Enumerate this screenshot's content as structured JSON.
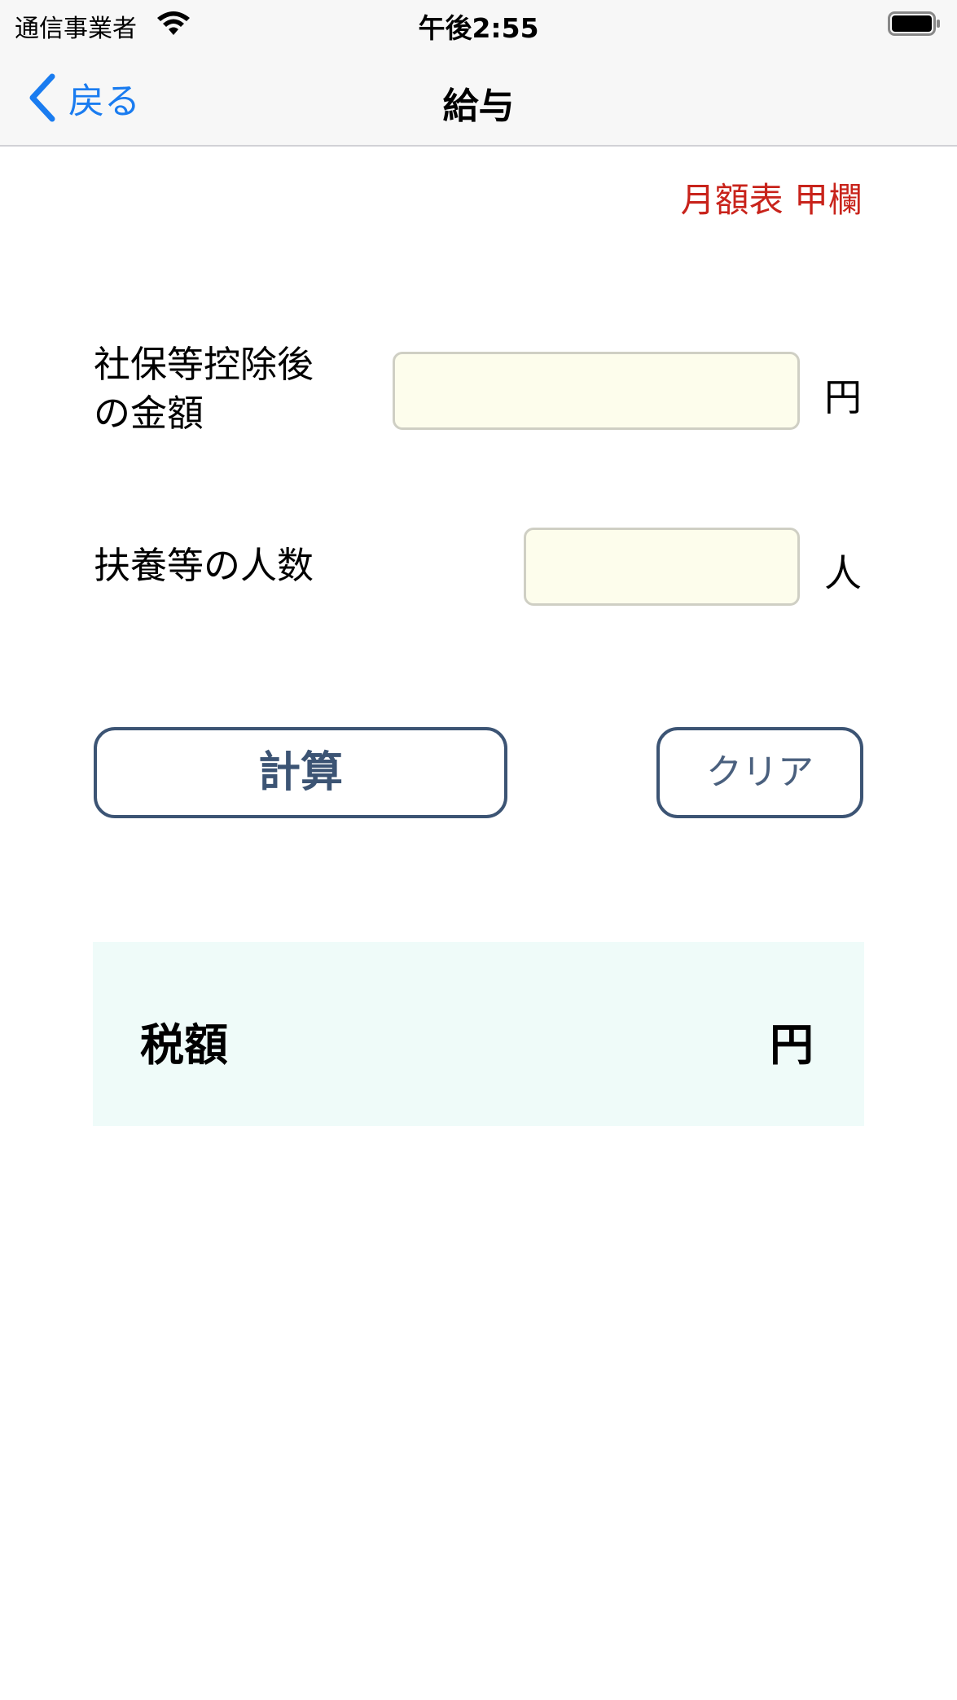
{
  "status_bar": {
    "carrier": "通信事業者",
    "time": "午後2:55",
    "icons": [
      "wifi-icon",
      "battery-icon"
    ]
  },
  "nav": {
    "back_label": "戻る",
    "title": "給与",
    "back_icon": "chevron-left-icon"
  },
  "form": {
    "table_label": "月額表 甲欄",
    "amount_label": "社保等控除後\nの金額",
    "amount_value": "",
    "amount_unit": "円",
    "dependents_label": "扶養等の人数",
    "dependents_value": "",
    "dependents_unit": "人"
  },
  "buttons": {
    "calculate": "計算",
    "clear": "クリア"
  },
  "result": {
    "label": "税額",
    "value": "",
    "unit": "円"
  },
  "colors": {
    "accent": "#1a7cf0",
    "warning": "#c8231b",
    "button_border": "#3c5474",
    "input_bg": "#fdfdec",
    "result_bg": "#effbf9"
  }
}
